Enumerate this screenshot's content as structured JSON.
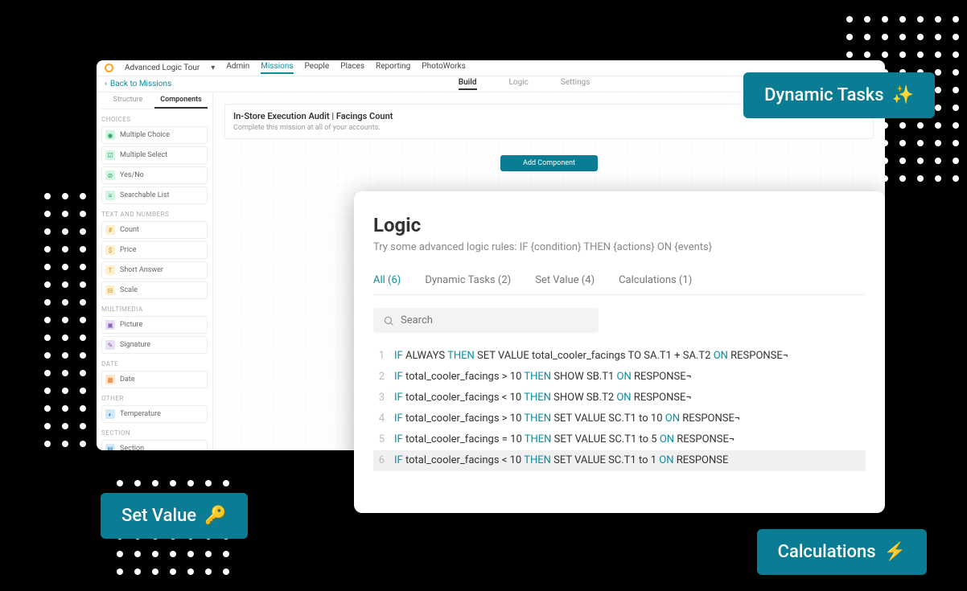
{
  "nav": {
    "brand": "Advanced Logic Tour",
    "items": [
      "Admin",
      "Missions",
      "People",
      "Places",
      "Reporting",
      "PhotoWorks"
    ],
    "active": "Missions",
    "back": "Back to Missions",
    "centerTabs": [
      "Build",
      "Logic",
      "Settings"
    ]
  },
  "sidebar": {
    "tabs": [
      "Structure",
      "Components"
    ],
    "sections": [
      {
        "title": "CHOICES",
        "items": [
          {
            "icon": "◉",
            "cls": "ic-green",
            "label": "Multiple Choice"
          },
          {
            "icon": "☑",
            "cls": "ic-green",
            "label": "Multiple Select"
          },
          {
            "icon": "⊘",
            "cls": "ic-green",
            "label": "Yes/No"
          },
          {
            "icon": "≡",
            "cls": "ic-green",
            "label": "Searchable List"
          }
        ]
      },
      {
        "title": "TEXT AND NUMBERS",
        "items": [
          {
            "icon": "#",
            "cls": "ic-yellow",
            "label": "Count"
          },
          {
            "icon": "$",
            "cls": "ic-yellow",
            "label": "Price"
          },
          {
            "icon": "T",
            "cls": "ic-yellow",
            "label": "Short Answer"
          },
          {
            "icon": "⊟",
            "cls": "ic-yellow",
            "label": "Scale"
          }
        ]
      },
      {
        "title": "MULTIMEDIA",
        "items": [
          {
            "icon": "▣",
            "cls": "ic-purple",
            "label": "Picture"
          },
          {
            "icon": "✎",
            "cls": "ic-purple",
            "label": "Signature"
          }
        ]
      },
      {
        "title": "DATE",
        "items": [
          {
            "icon": "▦",
            "cls": "ic-orange",
            "label": "Date"
          }
        ]
      },
      {
        "title": "OTHER",
        "items": [
          {
            "icon": "◐",
            "cls": "ic-blue",
            "label": "Temperature"
          }
        ]
      },
      {
        "title": "SECTION",
        "items": [
          {
            "icon": "▤",
            "cls": "ic-blue",
            "label": "Section"
          }
        ]
      }
    ]
  },
  "mission": {
    "title": "In-Store Execution Audit | Facings Count",
    "subtitle": "Complete this mission at all of your accounts.",
    "addBtn": "Add Component"
  },
  "logic": {
    "title": "Logic",
    "subtitle": "Try some advanced logic rules: IF {condition} THEN {actions} ON {events}",
    "tabs": [
      "All (6)",
      "Dynamic Tasks (2)",
      "Set Value (4)",
      "Calculations (1)"
    ],
    "searchPlaceholder": "Search",
    "lines": [
      {
        "n": 1,
        "tokens": [
          [
            "IF",
            "kw"
          ],
          [
            " ALWAYS ",
            ""
          ],
          [
            "THEN",
            "kw"
          ],
          [
            " SET VALUE total_cooler_facings TO SA.T1 + SA.T2 ",
            ""
          ],
          [
            "ON",
            "kw"
          ],
          [
            " RESPONSE¬",
            ""
          ]
        ]
      },
      {
        "n": 2,
        "tokens": [
          [
            "IF",
            "kw"
          ],
          [
            " total_cooler_facings > 10 ",
            ""
          ],
          [
            "THEN",
            "kw"
          ],
          [
            " SHOW SB.T1 ",
            ""
          ],
          [
            "ON",
            "kw"
          ],
          [
            " RESPONSE¬",
            ""
          ]
        ]
      },
      {
        "n": 3,
        "tokens": [
          [
            "IF",
            "kw"
          ],
          [
            " total_cooler_facings < 10 ",
            ""
          ],
          [
            "THEN",
            "kw"
          ],
          [
            " SHOW SB.T2 ",
            ""
          ],
          [
            "ON",
            "kw"
          ],
          [
            " RESPONSE¬",
            ""
          ]
        ]
      },
      {
        "n": 4,
        "tokens": [
          [
            "IF",
            "kw"
          ],
          [
            " total_cooler_facings > 10 ",
            ""
          ],
          [
            "THEN",
            "kw"
          ],
          [
            " SET VALUE SC.T1 to 10 ",
            ""
          ],
          [
            "ON",
            "kw"
          ],
          [
            " RESPONSE¬",
            ""
          ]
        ]
      },
      {
        "n": 5,
        "tokens": [
          [
            "IF",
            "kw"
          ],
          [
            " total_cooler_facings = 10 ",
            ""
          ],
          [
            "THEN",
            "kw"
          ],
          [
            " SET VALUE SC.T1 to 5 ",
            ""
          ],
          [
            "ON",
            "kw"
          ],
          [
            " RESPONSE¬",
            ""
          ]
        ]
      },
      {
        "n": 6,
        "tokens": [
          [
            "IF",
            "kw"
          ],
          [
            " total_cooler_facings < 10 ",
            ""
          ],
          [
            "THEN",
            "kw"
          ],
          [
            " SET VALUE SC.T1 to 1 ",
            ""
          ],
          [
            "ON",
            "kw"
          ],
          [
            " RESPONSE",
            ""
          ]
        ]
      }
    ]
  },
  "badges": {
    "dynamic": "Dynamic Tasks",
    "setvalue": "Set Value",
    "calc": "Calculations"
  }
}
